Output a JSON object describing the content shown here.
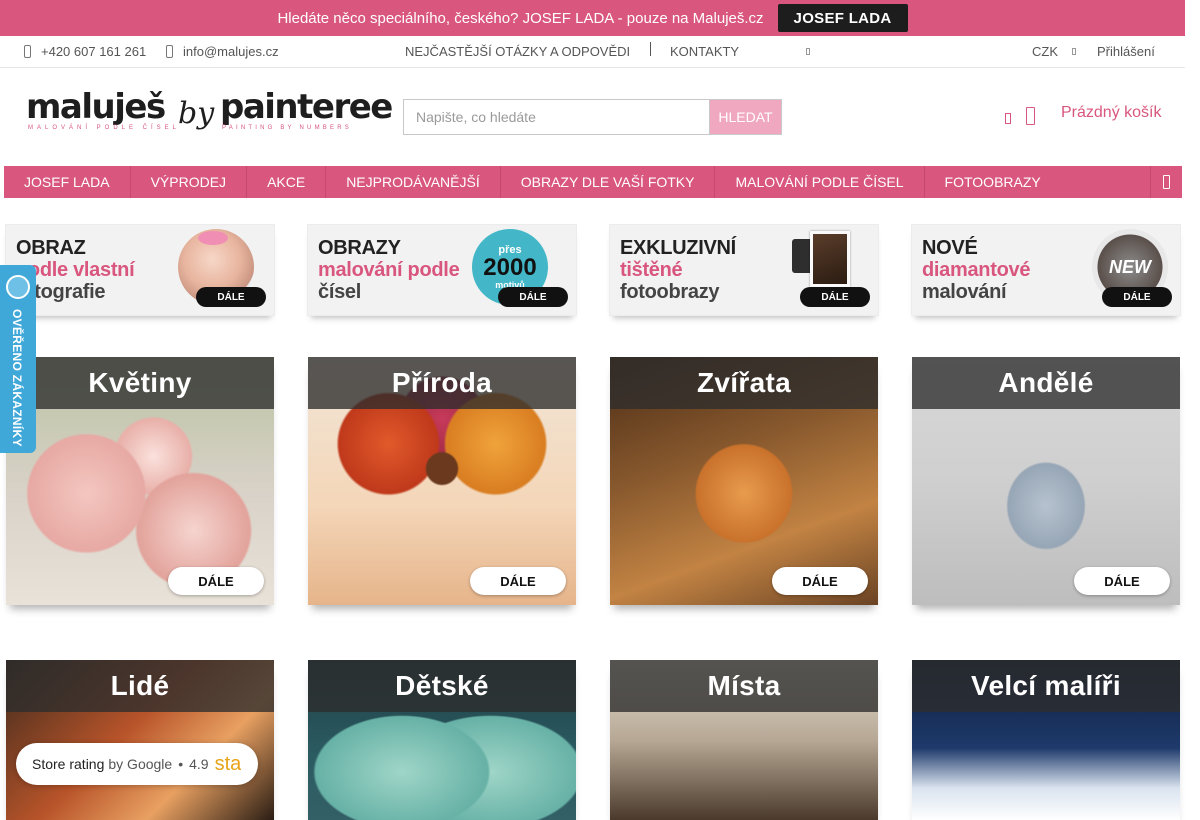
{
  "promo": {
    "text": "Hledáte něco speciálního, českého? JOSEF LADA - pouze na Maluješ.cz",
    "button": "JOSEF LADA"
  },
  "topbar": {
    "phone": "+420 607 161 261",
    "email": "info@malujes.cz",
    "faq": "NEJČASTĚJŠÍ OTÁZKY A ODPOVĚDI",
    "contacts": "KONTAKTY",
    "currency": "CZK",
    "login": "Přihlášení"
  },
  "logo": {
    "brand1": "maluješ",
    "brand1_sub": "MALOVÁNÍ PODLE ČÍSEL",
    "by": "by",
    "brand2": "painteree",
    "brand2_sub": "PAINTING BY NUMBERS"
  },
  "search": {
    "placeholder": "Napište, co hledáte",
    "button": "HLEDAT"
  },
  "cart": {
    "label": "Prázdný košík"
  },
  "nav": {
    "items": [
      "JOSEF LADA",
      "VÝPRODEJ",
      "AKCE",
      "NEJPRODÁVANĚJŠÍ",
      "OBRAZY DLE VAŠÍ FOTKY",
      "MALOVÁNÍ PODLE ČÍSEL",
      "FOTOOBRAZY"
    ]
  },
  "banners": [
    {
      "l1": "OBRAZ",
      "l2": "podle vlastní",
      "l3": "fotografie",
      "cta": "DÁLE"
    },
    {
      "l1": "OBRAZY",
      "l2": "malování podle",
      "l3": "čísel",
      "badge_top": "přes",
      "badge_num": "2000",
      "badge_bottom": "motivů",
      "cta": "DÁLE"
    },
    {
      "l1": "EXKLUZIVNÍ",
      "l2": "tištěné",
      "l3": "fotoobrazy",
      "cta": "DÁLE"
    },
    {
      "l1": "NOVÉ",
      "l2": "diamantové",
      "l3": "malování",
      "badge": "NEW",
      "cta": "DÁLE"
    }
  ],
  "categories": [
    {
      "title": "Květiny",
      "cta": "DÁLE"
    },
    {
      "title": "Příroda",
      "cta": "DÁLE"
    },
    {
      "title": "Zvířata",
      "cta": "DÁLE"
    },
    {
      "title": "Andělé",
      "cta": "DÁLE"
    },
    {
      "title": "Lidé"
    },
    {
      "title": "Dětské"
    },
    {
      "title": "Místa"
    },
    {
      "title": "Velcí malíři"
    }
  ],
  "side_badge": {
    "text": "OVĚŘENO ZÁKAZNÍKY"
  },
  "rating": {
    "label": "Store rating",
    "by": "by Google",
    "dot": "•",
    "score": "4.9",
    "stars": "sta"
  },
  "colors": {
    "accent": "#d9567e",
    "accent_light": "#f0a7c0",
    "badge_blue": "#3fa8d9"
  }
}
